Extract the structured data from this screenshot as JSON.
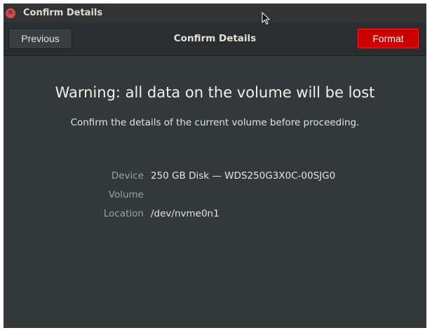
{
  "window": {
    "title": "Confirm Details"
  },
  "headerbar": {
    "title": "Confirm Details",
    "previous_label": "Previous",
    "format_label": "Format"
  },
  "content": {
    "warning": "Warning: all data on the volume will be lost",
    "subtitle": "Confirm the details of the current volume before proceeding.",
    "details": [
      {
        "key": "Device",
        "value": "250 GB Disk — WDS250G3X0C-00SJG0"
      },
      {
        "key": "Volume",
        "value": ""
      },
      {
        "key": "Location",
        "value": "/dev/nvme0n1"
      }
    ]
  },
  "colors": {
    "background": "#33393b",
    "headerbar": "#2b2e30",
    "destructive_button": "#cc0000",
    "close_button": "#d14b4b"
  },
  "icons": {
    "close": "close-icon",
    "pointer": "mouse-pointer-icon"
  }
}
